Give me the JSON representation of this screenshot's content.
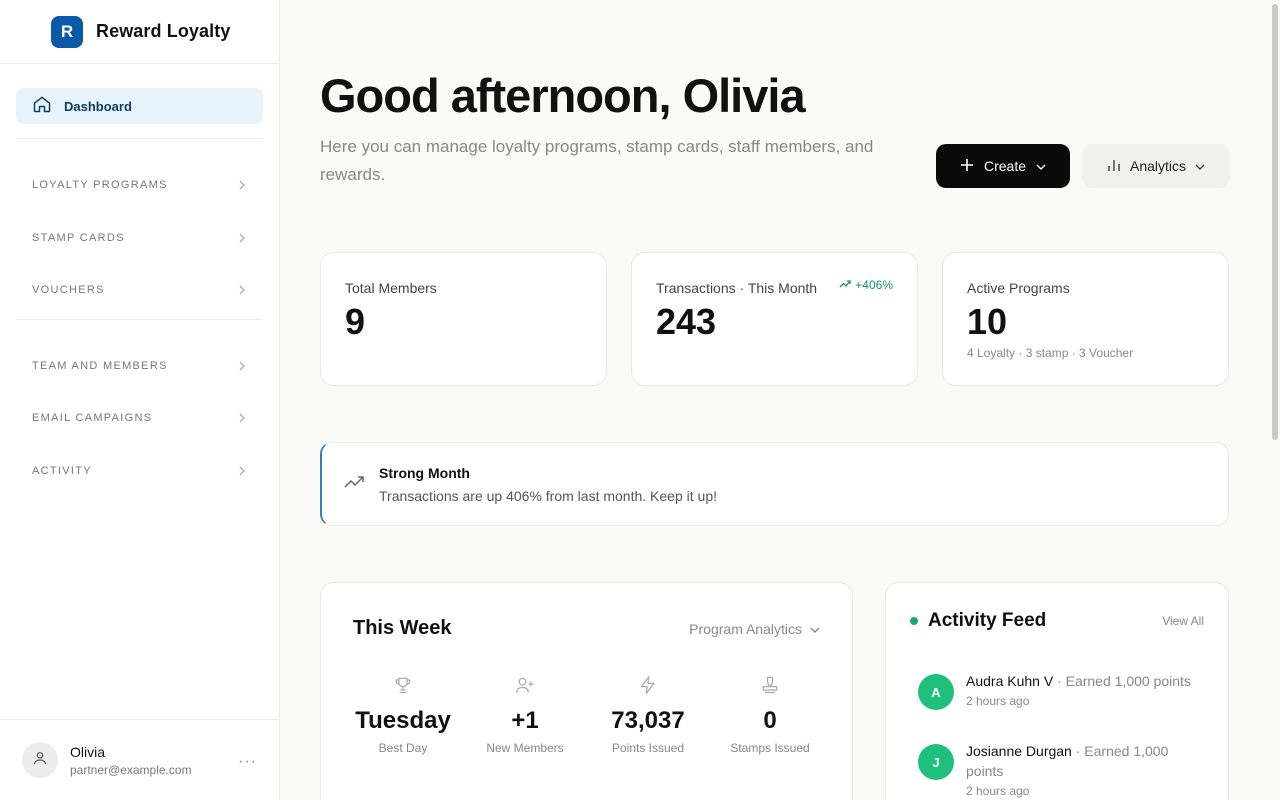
{
  "brand": {
    "logo_letter": "R",
    "name": "Reward Loyalty"
  },
  "sidebar": {
    "dashboard_label": "Dashboard",
    "items": [
      {
        "label": "LOYALTY PROGRAMS"
      },
      {
        "label": "STAMP CARDS"
      },
      {
        "label": "VOUCHERS"
      },
      {
        "label": "TEAM AND MEMBERS"
      },
      {
        "label": "EMAIL CAMPAIGNS"
      },
      {
        "label": "ACTIVITY"
      }
    ],
    "user": {
      "name": "Olivia",
      "email": "partner@example.com",
      "more": "···"
    }
  },
  "header": {
    "greeting": "Good afternoon, Olivia",
    "subtitle": "Here you can manage loyalty programs, stamp cards, staff members, and rewards.",
    "create_label": "Create",
    "analytics_label": "Analytics"
  },
  "stats": {
    "members": {
      "label": "Total Members",
      "value": "9"
    },
    "transactions": {
      "label": "Transactions · This Month",
      "value": "243",
      "trend": "+406%"
    },
    "programs": {
      "label": "Active Programs",
      "value": "10",
      "sub": "4 Loyalty · 3 stamp · 3 Voucher"
    }
  },
  "alert": {
    "title": "Strong Month",
    "message": "Transactions are up 406% from last month. Keep it up!"
  },
  "week": {
    "title": "This Week",
    "select_label": "Program Analytics",
    "metrics": [
      {
        "value": "Tuesday",
        "label": "Best Day",
        "icon": "trophy-icon"
      },
      {
        "value": "+1",
        "label": "New Members",
        "icon": "user-plus-icon"
      },
      {
        "value": "73,037",
        "label": "Points Issued",
        "icon": "lightning-icon"
      },
      {
        "value": "0",
        "label": "Stamps Issued",
        "icon": "stamp-icon"
      }
    ]
  },
  "feed": {
    "title": "Activity Feed",
    "view_all": "View All",
    "items": [
      {
        "initial": "A",
        "name": "Audra Kuhn V",
        "action": "· Earned 1,000 points",
        "time": "2 hours ago"
      },
      {
        "initial": "J",
        "name": "Josianne Durgan",
        "action": "· Earned 1,000 points",
        "time": "2 hours ago"
      }
    ]
  },
  "colors": {
    "brand": "#0b5aa8",
    "accent_green": "#1fbf7c",
    "trend_green": "#13956b",
    "alert_border": "#2f7fc1"
  }
}
